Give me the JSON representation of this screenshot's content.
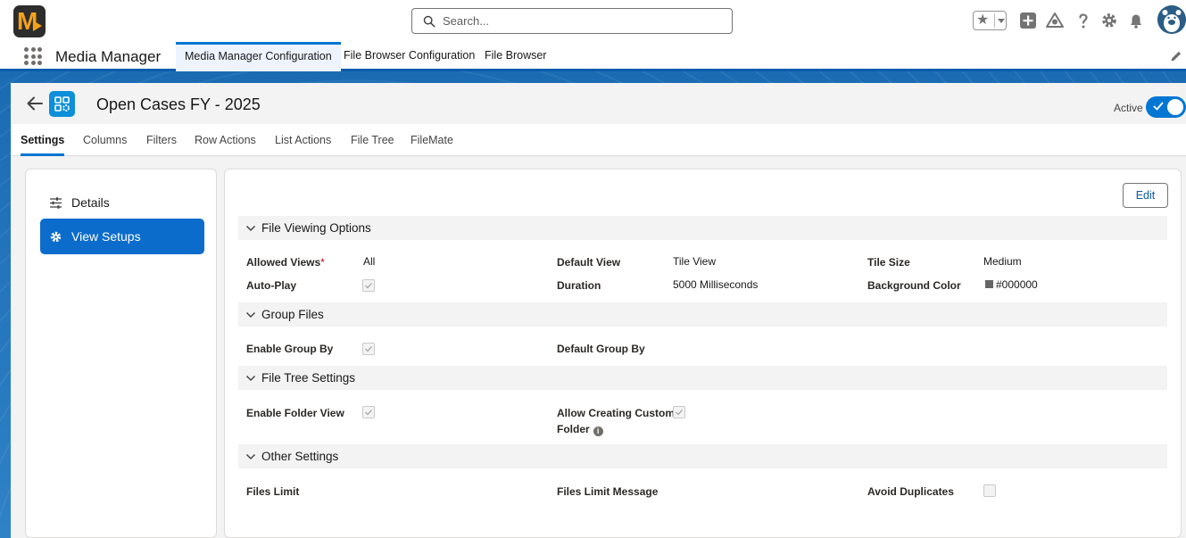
{
  "global_header": {
    "logo_text": "M",
    "search_placeholder": "Search..."
  },
  "app_nav": {
    "app_name": "Media Manager",
    "tabs": [
      {
        "label": "Media Manager Configuration",
        "active": true
      },
      {
        "label": "File Browser Configuration",
        "active": false
      },
      {
        "label": "File Browser",
        "active": false
      }
    ]
  },
  "record": {
    "title": "Open Cases FY - 2025",
    "active_label": "Active",
    "active": true
  },
  "subtabs": [
    "Settings",
    "Columns",
    "Filters",
    "Row Actions",
    "List Actions",
    "File Tree",
    "FileMate"
  ],
  "sidebar": {
    "items": [
      {
        "label": "Details",
        "selected": false
      },
      {
        "label": "View Setups",
        "selected": true
      }
    ]
  },
  "edit_label": "Edit",
  "sections": {
    "viewing": {
      "title": "File Viewing Options",
      "allowed_views_label": "Allowed Views",
      "required_mark": "*",
      "allowed_views_value": "All",
      "default_view_label": "Default View",
      "default_view_value": "Tile View",
      "tile_size_label": "Tile Size",
      "tile_size_value": "Medium",
      "auto_play_label": "Auto-Play",
      "auto_play_checked": true,
      "duration_label": "Duration",
      "duration_value": "5000 Milliseconds",
      "bg_color_label": "Background Color",
      "bg_color_value": "#000000"
    },
    "group": {
      "title": "Group Files",
      "enable_group_label": "Enable Group By",
      "enable_group_checked": true,
      "default_group_label": "Default Group By"
    },
    "tree": {
      "title": "File Tree Settings",
      "enable_folder_label": "Enable Folder View",
      "enable_folder_checked": true,
      "allow_custom_label_1": "Allow Creating Custom",
      "allow_custom_label_2": "Folder",
      "allow_custom_checked": true,
      "info_glyph": "i"
    },
    "other": {
      "title": "Other Settings",
      "files_limit_label": "Files Limit",
      "files_limit_msg_label": "Files Limit Message",
      "avoid_dup_label": "Avoid Duplicates",
      "avoid_dup_checked": false
    }
  },
  "colors": {
    "brand_blue": "#0176d3",
    "selected_bg": "#0b6ccc",
    "logo_orange": "#f5a21b"
  }
}
